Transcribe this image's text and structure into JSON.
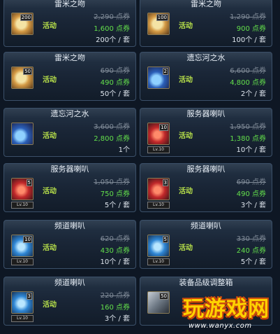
{
  "items": [
    {
      "name": "雷米之吻",
      "qty": "200",
      "tag": "活动",
      "old_price": "2,290 点券",
      "new_price": "1,600 点券",
      "unit": "200个 / 套",
      "icon": "cake-icon",
      "level": ""
    },
    {
      "name": "雷米之吻",
      "qty": "100",
      "tag": "活动",
      "old_price": "1,290 点券",
      "new_price": "900 点券",
      "unit": "100个 / 套",
      "icon": "cake-icon",
      "level": ""
    },
    {
      "name": "雷米之吻",
      "qty": "50",
      "tag": "活动",
      "old_price": "690 点券",
      "new_price": "490 点券",
      "unit": "50个 / 套",
      "icon": "cake-icon",
      "level": ""
    },
    {
      "name": "遗忘河之水",
      "qty": "2",
      "tag": "活动",
      "old_price": "6,600 点券",
      "new_price": "4,800 点券",
      "unit": "2个 / 套",
      "icon": "potion-icon",
      "level": ""
    },
    {
      "name": "遗忘河之水",
      "qty": "",
      "tag": "活动",
      "old_price": "3,600 点券",
      "new_price": "2,800 点券",
      "unit": "1个",
      "icon": "potion-icon",
      "level": ""
    },
    {
      "name": "服务器喇叭",
      "qty": "10",
      "tag": "活动",
      "old_price": "1,950 点券",
      "new_price": "1,380 点券",
      "unit": "10个 / 套",
      "icon": "red-horn-icon",
      "level": "Lv.10"
    },
    {
      "name": "服务器喇叭",
      "qty": "5",
      "tag": "活动",
      "old_price": "1,050 点券",
      "new_price": "750 点券",
      "unit": "5个 / 套",
      "icon": "red-horn-icon",
      "level": "Lv.10"
    },
    {
      "name": "服务器喇叭",
      "qty": "3",
      "tag": "活动",
      "old_price": "690 点券",
      "new_price": "490 点券",
      "unit": "3个 / 套",
      "icon": "red-horn-icon",
      "level": "Lv.10"
    },
    {
      "name": "频道喇叭",
      "qty": "10",
      "tag": "活动",
      "old_price": "620 点券",
      "new_price": "430 点券",
      "unit": "10个 / 套",
      "icon": "blue-horn-icon",
      "level": "Lv.10"
    },
    {
      "name": "频道喇叭",
      "qty": "5",
      "tag": "活动",
      "old_price": "330 点券",
      "new_price": "240 点券",
      "unit": "5个 / 套",
      "icon": "blue-horn-icon",
      "level": "Lv.10"
    },
    {
      "name": "频道喇叭",
      "qty": "3",
      "tag": "活动",
      "old_price": "220 点券",
      "new_price": "160 点券",
      "unit": "3个 / 套",
      "icon": "blue-horn-icon",
      "level": "Lv.10"
    },
    {
      "name": "装备品级调整箱",
      "qty": "50",
      "tag": "",
      "old_price": "",
      "new_price": "",
      "unit": "",
      "icon": "box-icon",
      "level": ""
    }
  ],
  "watermark": {
    "logo": "玩游戏网",
    "url": "www.wanyx.com"
  },
  "colors": {
    "tag": "#b7e04a",
    "new_price": "#63e04b",
    "old_price": "#7f8a97",
    "title": "#e6edf5"
  }
}
